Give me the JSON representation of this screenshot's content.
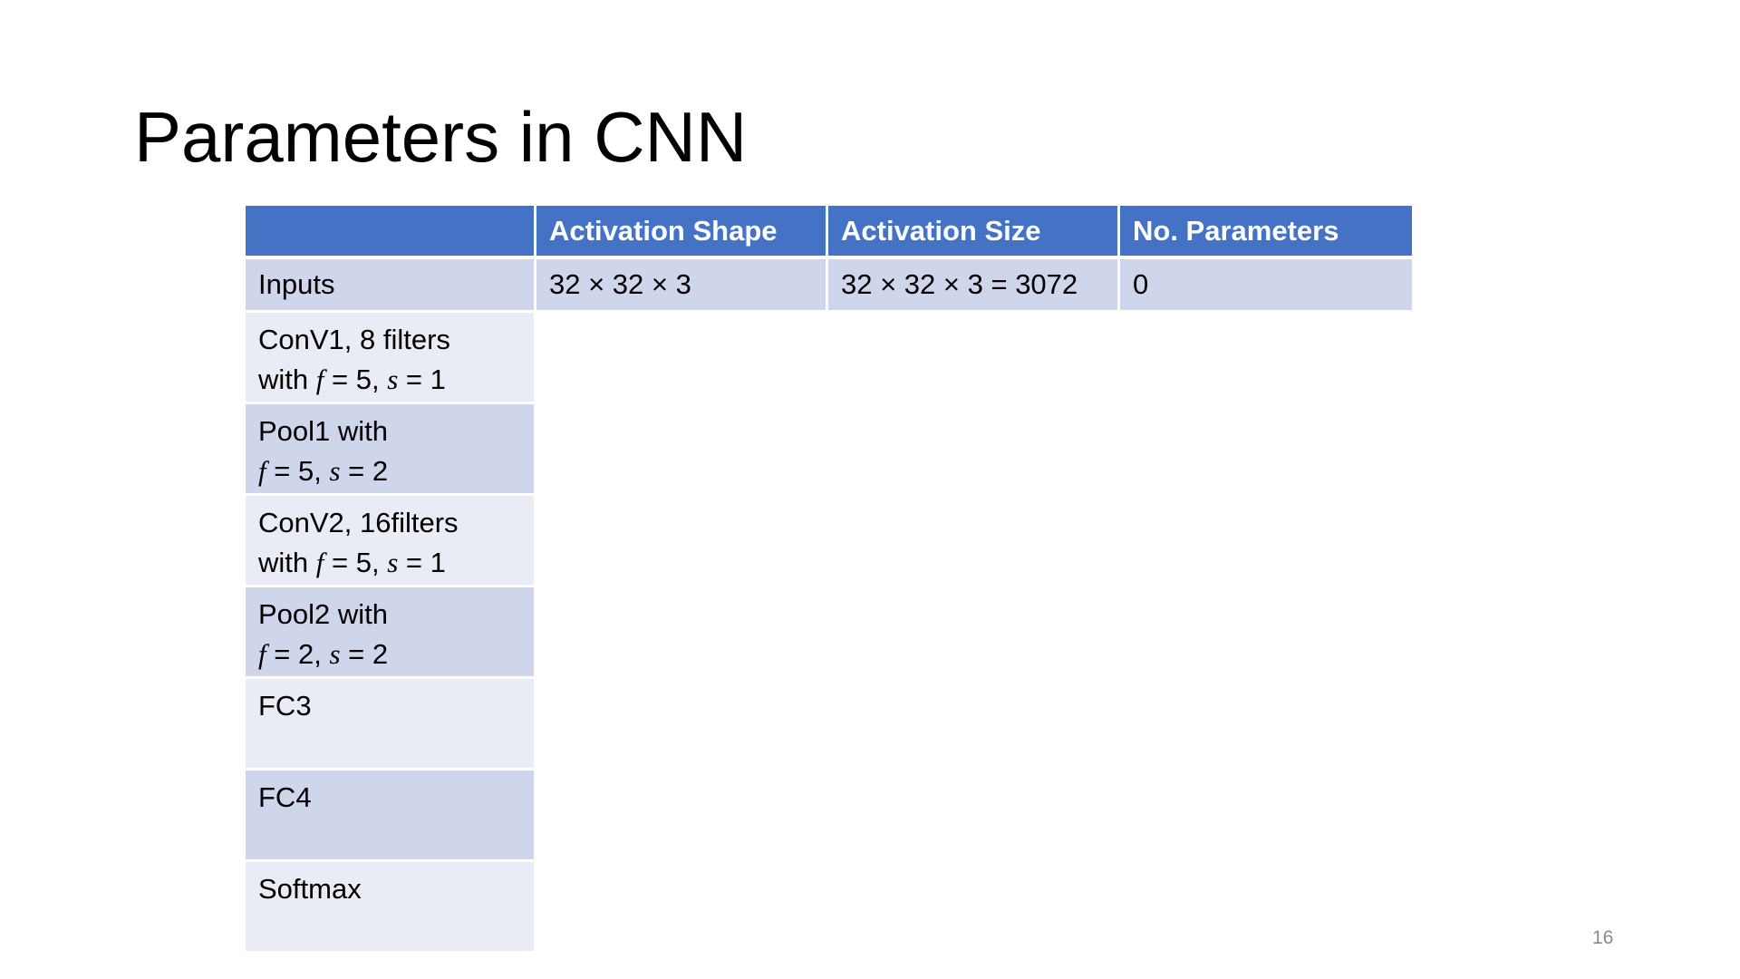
{
  "slide": {
    "title": "Parameters in CNN",
    "page_number": "16"
  },
  "table": {
    "headers": [
      "",
      "Activation Shape",
      "Activation Size",
      "No. Parameters"
    ],
    "rows": [
      {
        "label_line1": "Inputs",
        "activation_shape": "32 × 32 × 3",
        "activation_size": "32 × 32 × 3 = 3072",
        "no_parameters": "0"
      },
      {
        "label_line1": "ConV1, 8 filters",
        "label_line2_prefix": "with ",
        "f_symbol": "f",
        "f_value": " = 5,",
        "s_symbol": "s",
        "s_value": " = 1"
      },
      {
        "label_line1": "Pool1 with",
        "label_line2_prefix": "",
        "f_symbol": "f",
        "f_value": " = 5,",
        "s_symbol": "s",
        "s_value": " = 2"
      },
      {
        "label_line1": "ConV2, 16filters",
        "label_line2_prefix": "with ",
        "f_symbol": "f",
        "f_value": " = 5,",
        "s_symbol": "s",
        "s_value": " = 1"
      },
      {
        "label_line1": "Pool2 with",
        "label_line2_prefix": "",
        "f_symbol": "f",
        "f_value": " = 2,",
        "s_symbol": "s",
        "s_value": " = 2"
      },
      {
        "label_line1": "FC3"
      },
      {
        "label_line1": "FC4"
      },
      {
        "label_line1": "Softmax"
      }
    ]
  },
  "colors": {
    "header_background": "#4472c4",
    "row_dark": "#cfd5ea",
    "row_light": "#e9ebf5",
    "page_number": "#8a8a8a"
  }
}
